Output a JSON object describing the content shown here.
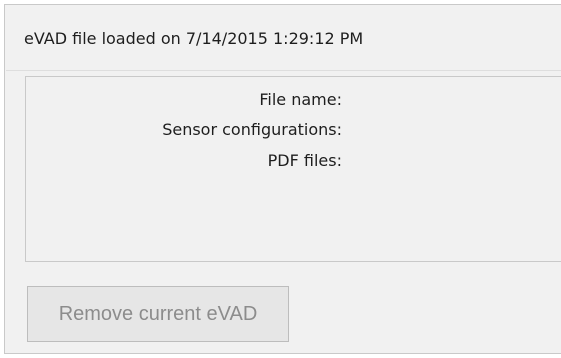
{
  "header": {
    "status_text": "eVAD file loaded on 7/14/2015 1:29:12 PM"
  },
  "info": {
    "file_name_label": "File name:",
    "sensor_configurations_label": "Sensor configurations:",
    "pdf_files_label": "PDF files:"
  },
  "actions": {
    "remove_label": "Remove current eVAD",
    "remove_enabled": false
  },
  "colors": {
    "panel_background": "#f1f1f1",
    "border": "#c9c9c9",
    "disabled_text": "#8c8c8c"
  }
}
